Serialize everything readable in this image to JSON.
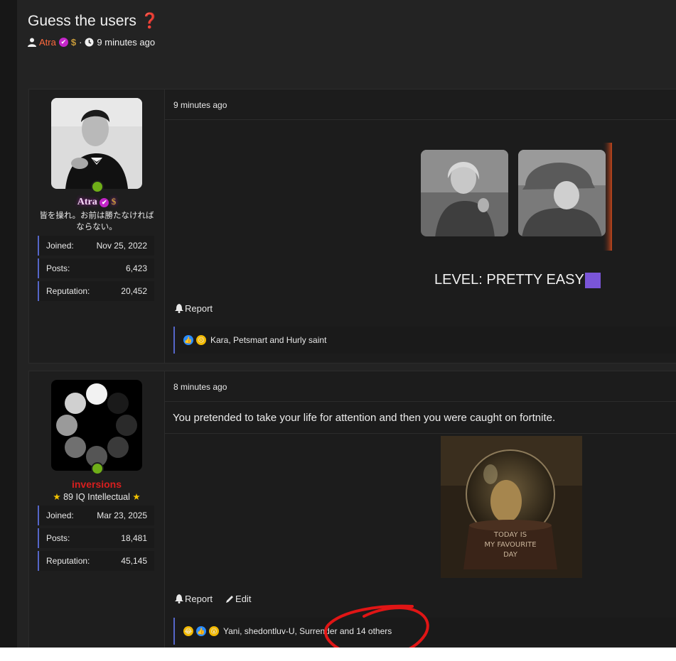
{
  "thread": {
    "title": "Guess the users",
    "title_icon": "question-mark-icon",
    "author": "Atra",
    "separator": "·",
    "time": "9 minutes ago"
  },
  "posts": [
    {
      "user": {
        "name": "Atra",
        "subtitle": "皆を操れ。お前は勝たなければならない。",
        "stats": [
          {
            "label": "Joined:",
            "value": "Nov 25, 2022"
          },
          {
            "label": "Posts:",
            "value": "6,423"
          },
          {
            "label": "Reputation:",
            "value": "20,452"
          }
        ]
      },
      "time": "9 minutes ago",
      "level_text": "LEVEL: PRETTY EASY",
      "actions": {
        "report": "Report"
      },
      "reactions": {
        "text": "Kara, Petsmart and Hurly saint"
      }
    },
    {
      "user": {
        "name": "inversions",
        "subtitle": "89 IQ Intellectual",
        "stats": [
          {
            "label": "Joined:",
            "value": "Mar 23, 2025"
          },
          {
            "label": "Posts:",
            "value": "18,481"
          },
          {
            "label": "Reputation:",
            "value": "45,145"
          }
        ]
      },
      "time": "8 minutes ago",
      "body": "You pretended to take your life for attention and then you were caught on fortnite.",
      "image_caption": "TODAY IS MY FAVOURITE DAY",
      "actions": {
        "report": "Report",
        "edit": "Edit"
      },
      "reactions": {
        "text": "Yani, shedontluv-U, Surrender and 14 others"
      }
    }
  ],
  "colors": {
    "page_bg": "#232323",
    "atra_name": "#ff6a3d",
    "verified": "#c426c9",
    "inversions_name": "#d81e1e",
    "online": "#6fae18",
    "stat_accent": "#5566c8",
    "annotation": "#e01515"
  }
}
